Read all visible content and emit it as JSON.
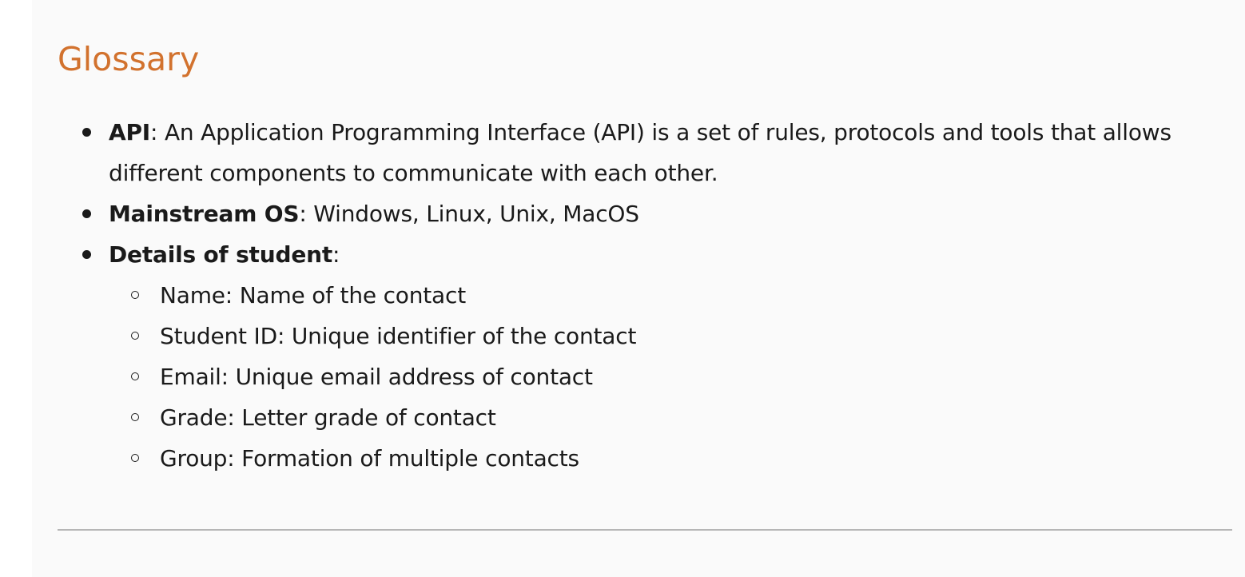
{
  "heading": "Glossary",
  "items": [
    {
      "term": "API",
      "definition": ": An Application Programming Interface (API) is a set of rules, protocols and tools that allows different components to communicate with each other."
    },
    {
      "term": "Mainstream OS",
      "definition": ": Windows, Linux, Unix, MacOS"
    },
    {
      "term": "Details of student",
      "definition": ":",
      "subitems": [
        "Name: Name of the contact",
        "Student ID: Unique identifier of the contact",
        "Email: Unique email address of contact",
        "Grade: Letter grade of contact",
        "Group: Formation of multiple contacts"
      ]
    }
  ],
  "colors": {
    "heading": "#d2722e",
    "text": "#1a1a1a",
    "page_background": "#fafafa",
    "rule": "#b6b6b6"
  }
}
